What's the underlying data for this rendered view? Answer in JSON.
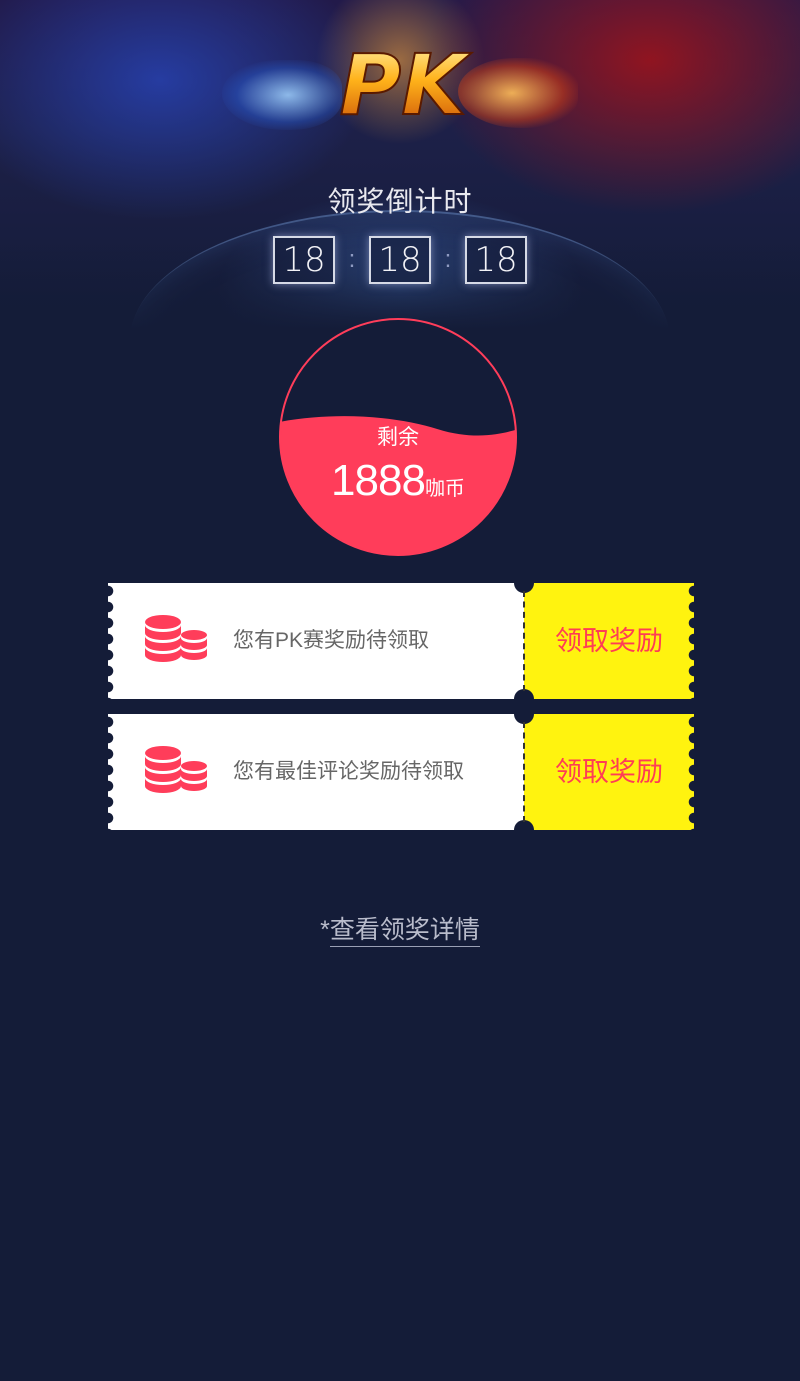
{
  "banner": {
    "logo_text": "PK",
    "title": "领奖倒计时"
  },
  "countdown": {
    "hours": "18",
    "minutes": "18",
    "seconds": "18",
    "separator": ":"
  },
  "balance": {
    "label": "剩余",
    "value": "1888",
    "unit": "咖币",
    "fill_fraction": 0.55,
    "color": "#ff3d5a"
  },
  "rewards": [
    {
      "message": "您有PK赛奖励待领取",
      "button_label": "领取奖励",
      "icon": "coins-icon"
    },
    {
      "message": "您有最佳评论奖励待领取",
      "button_label": "领取奖励",
      "icon": "coins-icon"
    }
  ],
  "details_link": {
    "prefix": "*",
    "label": "查看领奖详情"
  },
  "colors": {
    "background": "#141c38",
    "accent": "#ff3d55",
    "button_bg": "#fff30f"
  }
}
